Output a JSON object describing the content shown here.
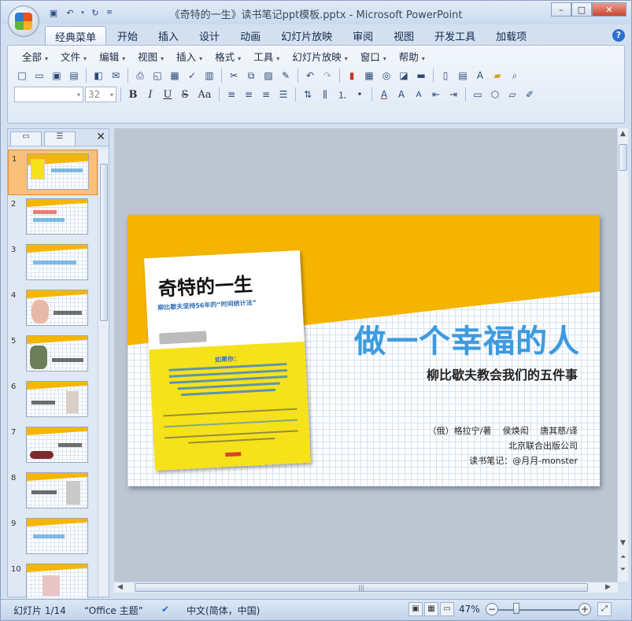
{
  "window": {
    "title": "《奇特的一生》读书笔记ppt模板.pptx - Microsoft PowerPoint",
    "minimize": "–",
    "maximize": "□",
    "close": "✕"
  },
  "ribbon_tabs": [
    "经典菜单",
    "开始",
    "插入",
    "设计",
    "动画",
    "幻灯片放映",
    "审阅",
    "视图",
    "开发工具",
    "加载项"
  ],
  "menubar": [
    "全部",
    "文件",
    "编辑",
    "视图",
    "插入",
    "格式",
    "工具",
    "幻灯片放映",
    "窗口",
    "帮助"
  ],
  "toolbar": {
    "font_name": "",
    "font_size": "32",
    "bold": "B",
    "italic": "I",
    "underline": "U",
    "strike": "S",
    "case": "Aa"
  },
  "left_pane": {
    "close": "✕",
    "slide_numbers": [
      "1",
      "2",
      "3",
      "4",
      "5",
      "6",
      "7",
      "8",
      "9",
      "10"
    ],
    "selected_slide": 1
  },
  "slide": {
    "title": "做一个幸福的人",
    "subtitle": "柳比歇夫教会我们的五件事",
    "credit_authors": "（俄）格拉宁/著　 侯焕闳　 唐其慈/译",
    "credit_publisher": "北京联合出版公司",
    "credit_notes": "读书笔记：@月月-monster",
    "book": {
      "title": "奇特的一生",
      "tagline": "柳比歇夫坚持56年的“时间统计法”",
      "ask": "如果你："
    }
  },
  "status": {
    "slide_position": "幻灯片 1/14",
    "theme": "“Office 主题”",
    "language": "中文(简体，中国)",
    "zoom": "47%"
  },
  "colors": {
    "accent_yellow": "#f5b400",
    "title_blue": "#3d9adf"
  }
}
